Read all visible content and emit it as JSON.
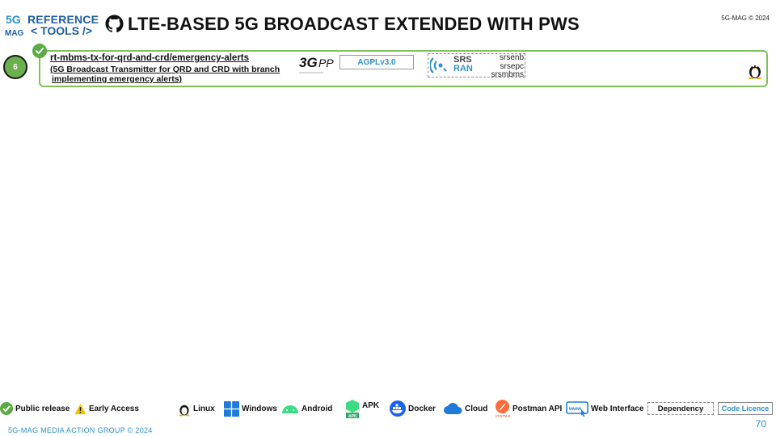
{
  "header": {
    "logo_line1": "REFERENCE",
    "logo_line2": "< TOOLS />",
    "title": "LTE-BASED 5G BROADCAST EXTENDED WITH PWS",
    "copyright": "5G-MAG © 2024"
  },
  "card": {
    "number": "6",
    "repo_name": "rt-mbms-tx-for-qrd-and-crd/emergency-alerts",
    "description_line1": "(5G Broadcast Transmitter for QRD and CRD with branch",
    "description_line2": "implementing emergency alerts)",
    "licence": "AGPLv3.0",
    "dependency_logo_line1": "SRS",
    "dependency_logo_line2": "RAN",
    "dependencies": [
      "srsenb",
      "srsepc",
      "srsmbms"
    ],
    "status_icon": "public-release-check-icon",
    "platform_icon": "linux-icon"
  },
  "legend": {
    "public_release": "Public release",
    "early_access": "Early Access",
    "linux": "Linux",
    "windows": "Windows",
    "android": "Android",
    "apk": "APK",
    "docker": "Docker",
    "cloud": "Cloud",
    "postman": "Postman API",
    "web": "Web Interface",
    "dependency": "Dependency",
    "code_licence": "Code Licence"
  },
  "footer": {
    "text": "5G-MAG MEDIA ACTION GROUP © 2024",
    "page_number": "70"
  },
  "colors": {
    "accent_blue": "#2b8fd1",
    "brand_blue": "#1f5fa8",
    "release_green": "#6ab04c",
    "card_border": "#7fc05c"
  }
}
